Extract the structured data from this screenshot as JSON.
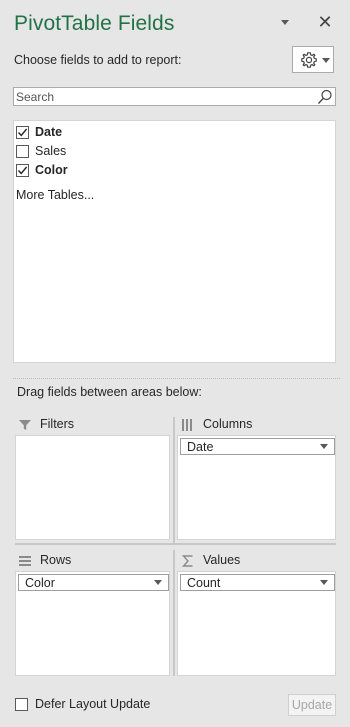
{
  "header": {
    "title": "PivotTable Fields",
    "close_glyph": "✕",
    "choose_label": "Choose fields to add to report:",
    "tools_icon": "gear-icon",
    "title_color": "#217346"
  },
  "search": {
    "placeholder": "Search",
    "value": ""
  },
  "fields": [
    {
      "label": "Date",
      "checked": true,
      "bold": true
    },
    {
      "label": "Sales",
      "checked": false,
      "bold": false
    },
    {
      "label": "Color",
      "checked": true,
      "bold": true
    }
  ],
  "more_tables": "More Tables...",
  "areas": {
    "instruction": "Drag fields between areas below:",
    "filters": {
      "label": "Filters",
      "icon": "filter-icon",
      "items": []
    },
    "columns": {
      "label": "Columns",
      "icon": "columns-icon",
      "items": [
        "Date"
      ]
    },
    "rows": {
      "label": "Rows",
      "icon": "rows-icon",
      "items": [
        "Color"
      ]
    },
    "values": {
      "label": "Values",
      "icon": "sigma-icon",
      "items": [
        "Count"
      ]
    }
  },
  "footer": {
    "defer_label": "Defer Layout Update",
    "defer_checked": false,
    "update_label": "Update"
  }
}
